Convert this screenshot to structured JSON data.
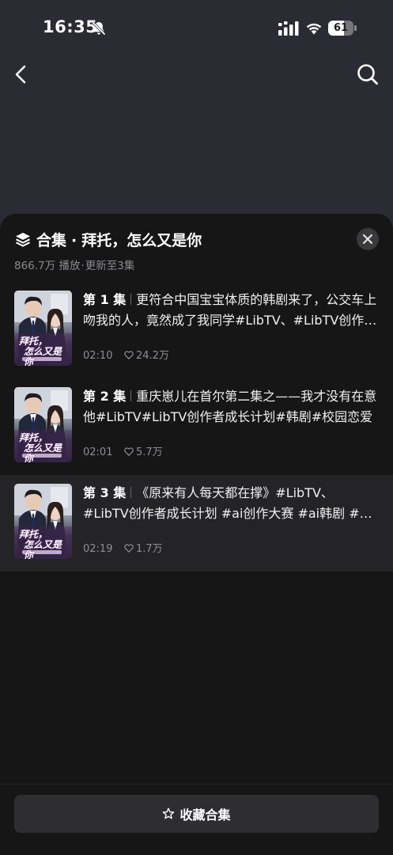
{
  "status_bar": {
    "time": "16:35",
    "battery_level": "61",
    "battery_fraction": 0.61,
    "icons": [
      "bell-slash-icon",
      "signal-icon",
      "wifi-icon",
      "battery-icon"
    ]
  },
  "nav": {
    "back_icon": "chevron-left-icon",
    "search_icon": "search-icon"
  },
  "collection": {
    "label": "合集",
    "separator": "·",
    "title": "拜托，怎么又是你",
    "plays": "866.7万 播放",
    "meta_separator": "·",
    "update_status": "更新至3集"
  },
  "thumbnail_text": {
    "line1": "拜托，",
    "line2": "怎么又是你"
  },
  "episodes": [
    {
      "number": "第 1 集",
      "title": "更符合中国宝宝体质的韩剧来了，公交车上吻我的人，竟然成了我同学#LibTV、#LibTV创作者成长计划",
      "duration": "02:10",
      "likes": "24.2万",
      "active": false
    },
    {
      "number": "第 2 集",
      "title": "重庆崽儿在首尔第二集之——我才没有在意他#LibTV#LibTV创作者成长计划#韩剧#校园恋爱",
      "duration": "02:01",
      "likes": "5.7万",
      "active": false
    },
    {
      "number": "第 3 集",
      "title": "《原来有人每天都在撑》#LibTV、#LibTV创作者成长计划 #ai创作大赛 #ai韩剧 #恋爱",
      "duration": "02:19",
      "likes": "1.7万",
      "active": true
    }
  ],
  "footer": {
    "collect_label": "收藏合集",
    "collect_icon": "star-icon"
  },
  "colors": {
    "page_background": "#2b2b33",
    "sheet_background": "#161616",
    "active_row": "#242426",
    "secondary_text": "#8a8a8f"
  }
}
